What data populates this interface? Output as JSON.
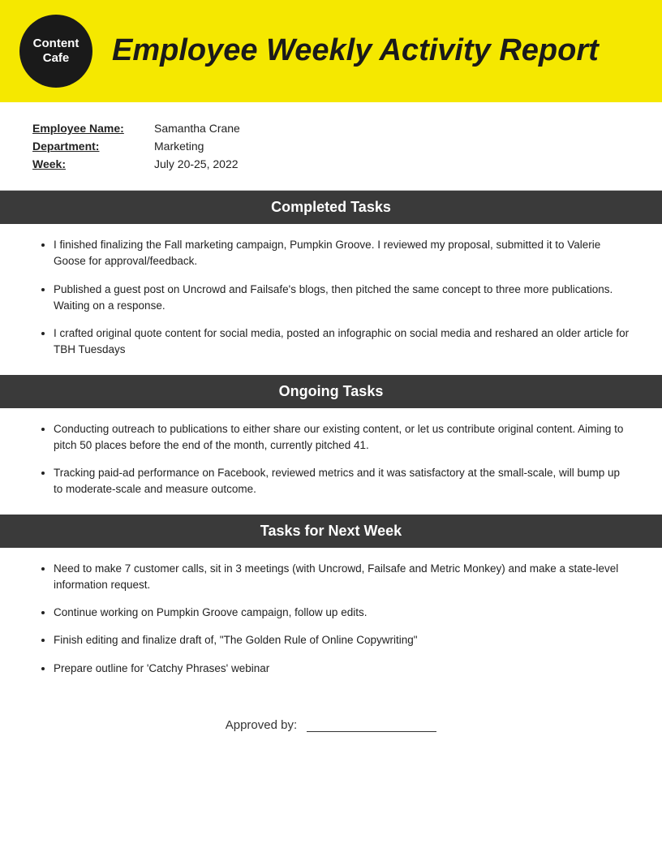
{
  "header": {
    "logo_line1": "Content",
    "logo_line2": "Cafe",
    "title": "Employee Weekly Activity Report"
  },
  "employee": {
    "name_label": "Employee Name:",
    "name_value": "Samantha Crane",
    "department_label": "Department:",
    "department_value": "Marketing",
    "week_label": "Week:",
    "week_value": "July 20-25, 2022"
  },
  "sections": [
    {
      "id": "completed",
      "heading": "Completed Tasks",
      "items": [
        "I finished finalizing the Fall marketing campaign, Pumpkin Groove. I reviewed my proposal, submitted it to Valerie Goose for approval/feedback.",
        "Published a guest post on Uncrowd and Failsafe's blogs, then pitched the same concept to three more publications. Waiting on a response.",
        "I crafted original quote content for social media, posted an infographic on social media and reshared an older article for TBH Tuesdays"
      ]
    },
    {
      "id": "ongoing",
      "heading": "Ongoing Tasks",
      "items": [
        "Conducting outreach to publications to either share our existing content, or let us contribute original content. Aiming to pitch 50 places before the end of the month, currently pitched 41.",
        "Tracking paid-ad performance on Facebook, reviewed metrics and it was satisfactory at the small-scale, will bump up to moderate-scale and measure outcome."
      ]
    },
    {
      "id": "next-week",
      "heading": "Tasks for Next Week",
      "items": [
        "Need to make 7 customer calls, sit in 3 meetings (with Uncrowd, Failsafe and Metric Monkey) and make a state-level information request.",
        "Continue working on Pumpkin Groove campaign, follow up edits.",
        "Finish editing and finalize draft of, \"The Golden Rule of Online Copywriting\"",
        "Prepare outline for 'Catchy Phrases' webinar"
      ]
    }
  ],
  "approved": {
    "label": "Approved by:"
  }
}
